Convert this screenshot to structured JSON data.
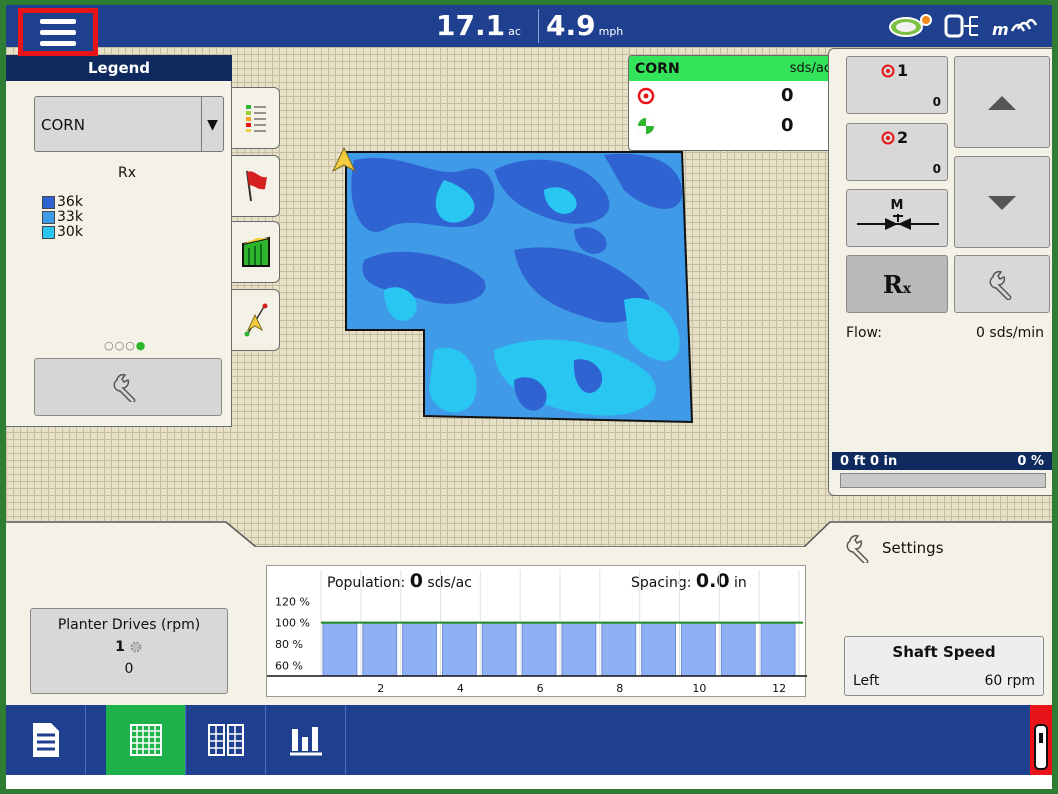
{
  "topbar": {
    "area_value": "17.1",
    "area_unit": "ac",
    "speed_value": "4.9",
    "speed_unit": "mph"
  },
  "legend": {
    "title": "Legend",
    "crop": "CORN",
    "layer": "Rx",
    "items": [
      {
        "label": "36k",
        "color": "#2f63d1"
      },
      {
        "label": "33k",
        "color": "#3f9be8"
      },
      {
        "label": "30k",
        "color": "#29c6f2"
      }
    ],
    "page_dots": {
      "total": 4,
      "active": 4
    }
  },
  "corn_status": {
    "crop": "CORN",
    "unit": "sds/ac",
    "target_rate": "0",
    "applied_rate": "0"
  },
  "right_panel": {
    "product1_label": "1",
    "product1_value": "0",
    "product2_label": "2",
    "product2_value": "0",
    "manual_label": "M",
    "rx_label": "R",
    "flow_label": "Flow:",
    "flow_value": "0 sds/min",
    "depth_label": "0 ft 0 in",
    "depth_percent": "0 %"
  },
  "lower": {
    "settings_label": "Settings",
    "planter_drives_title": "Planter Drives (rpm)",
    "planter_drive_number": "1",
    "planter_drive_value": "0",
    "shaft_speed_title": "Shaft Speed",
    "shaft_side": "Left",
    "shaft_value": "60 rpm"
  },
  "chart_data": {
    "type": "bar",
    "population_label": "Population:",
    "population_value": "0",
    "population_unit": "sds/ac",
    "spacing_label": "Spacing:",
    "spacing_value": "0.0",
    "spacing_unit": "in",
    "y_ticks": [
      "120 %",
      "100 %",
      "80 %",
      "60 %"
    ],
    "x_ticks": [
      "2",
      "4",
      "6",
      "8",
      "10",
      "12"
    ],
    "categories": [
      1,
      2,
      3,
      4,
      5,
      6,
      7,
      8,
      9,
      10,
      11,
      12
    ],
    "values": [
      100,
      100,
      100,
      100,
      100,
      100,
      100,
      100,
      100,
      100,
      100,
      100
    ],
    "ylim": [
      50,
      125
    ],
    "target_line": 100,
    "bar_color": "#8fb0f5",
    "line_color": "#1e8a1e"
  },
  "colors": {
    "topbar": "#1f3f8f",
    "active_tab": "#1fb24a",
    "highlight": "#e8141a",
    "corn_header": "#33e35a"
  }
}
